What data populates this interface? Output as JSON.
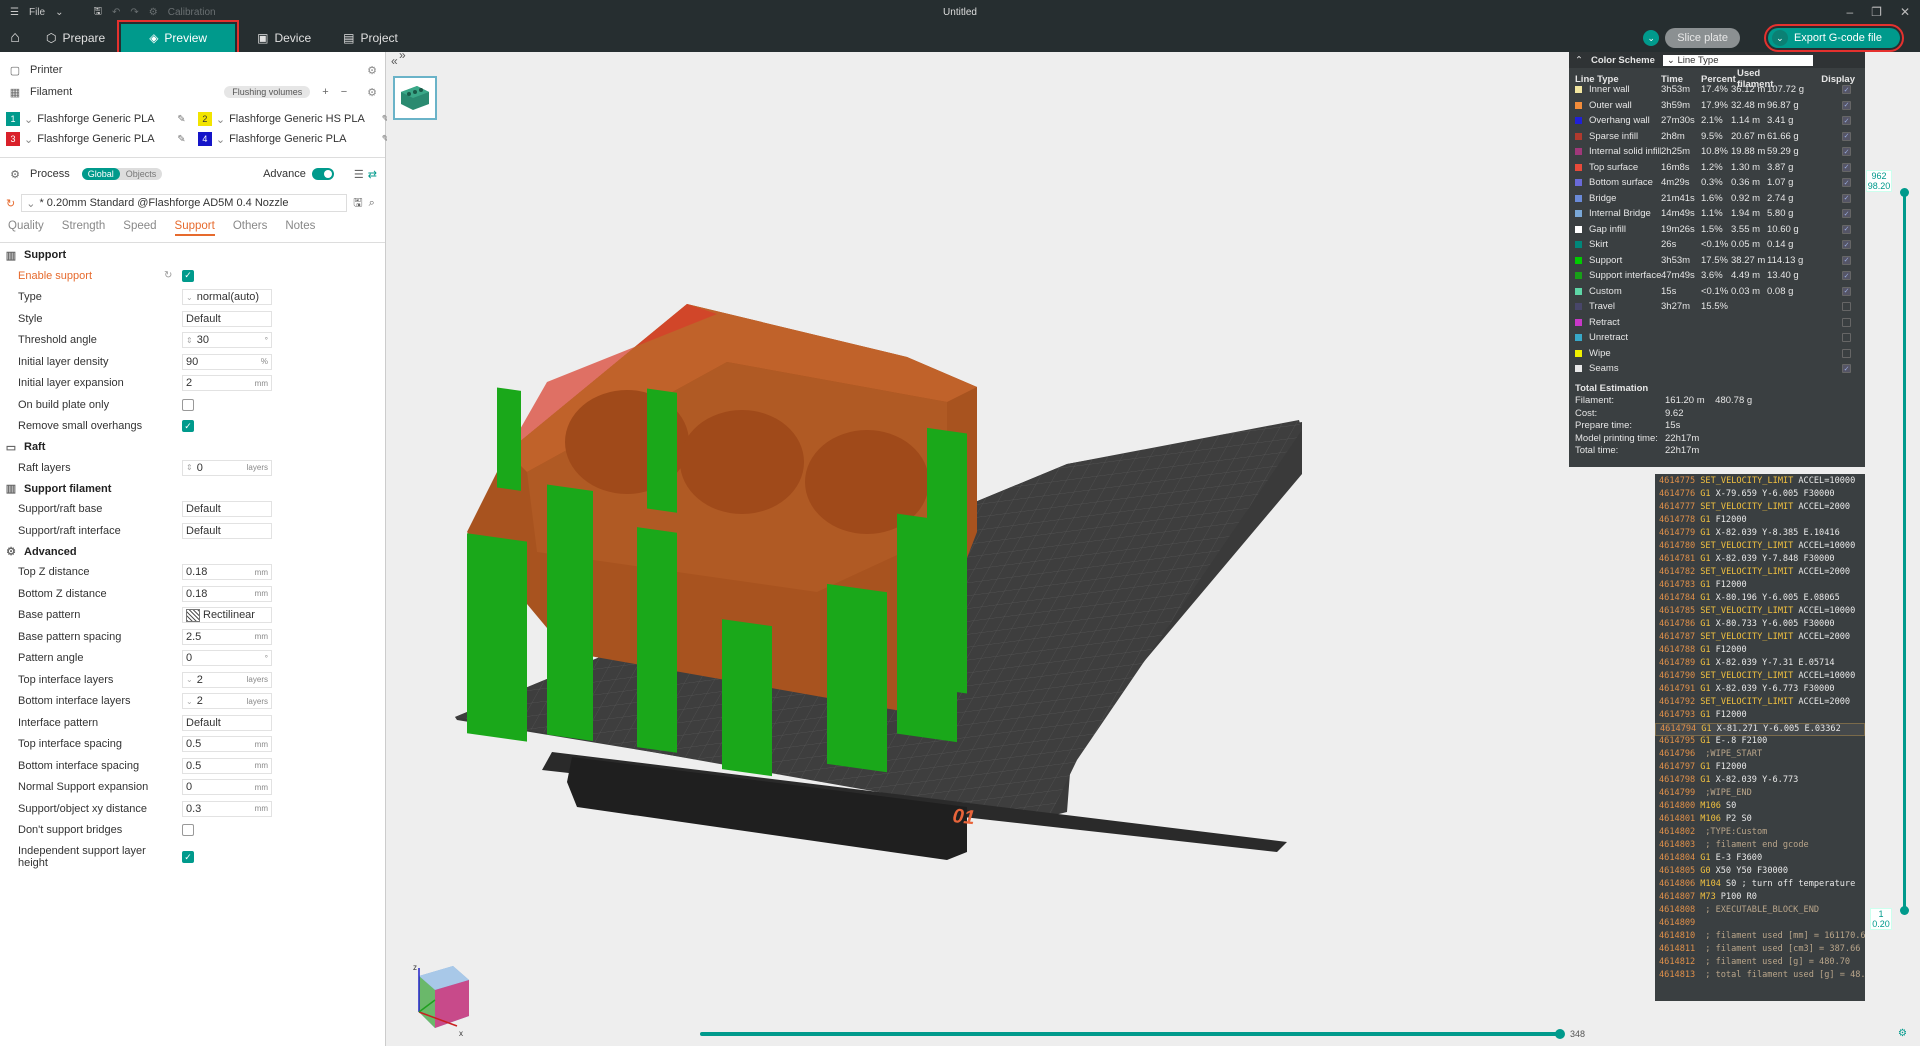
{
  "titlebar": {
    "file_label": "File",
    "calibration_label": "Calibration",
    "title": "Untitled"
  },
  "toolbar": {
    "tabs": [
      {
        "label": "Prepare",
        "icon": "cube-icon"
      },
      {
        "label": "Preview",
        "icon": "layers-icon"
      },
      {
        "label": "Device",
        "icon": "device-icon"
      },
      {
        "label": "Project",
        "icon": "project-icon"
      }
    ],
    "slice_label": "Slice plate",
    "export_label": "Export G-code file"
  },
  "sidebar": {
    "printer_label": "Printer",
    "filament_label": "Filament",
    "flushing_label": "Flushing volumes",
    "filaments": [
      {
        "num": "1",
        "name": "Flashforge Generic PLA",
        "color": "#009a8c"
      },
      {
        "num": "2",
        "name": "Flashforge Generic HS PLA",
        "color": "#f2e400"
      },
      {
        "num": "3",
        "name": "Flashforge Generic PLA",
        "color": "#d9212a"
      },
      {
        "num": "4",
        "name": "Flashforge Generic PLA",
        "color": "#1515c8"
      }
    ],
    "process_label": "Process",
    "global_label": "Global",
    "objects_label": "Objects",
    "advance_label": "Advance",
    "preset": "* 0.20mm Standard @Flashforge AD5M 0.4 Nozzle",
    "subtabs": [
      "Quality",
      "Strength",
      "Speed",
      "Support",
      "Others",
      "Notes"
    ],
    "support_section": "Support",
    "enable_support": "Enable support",
    "type_label": "Type",
    "type_value": "normal(auto)",
    "style_label": "Style",
    "style_value": "Default",
    "threshold_label": "Threshold angle",
    "threshold_value": "30",
    "threshold_unit": "°",
    "init_density_label": "Initial layer density",
    "init_density_value": "90",
    "init_density_unit": "%",
    "init_expansion_label": "Initial layer expansion",
    "init_expansion_value": "2",
    "mm": "mm",
    "on_plate_label": "On build plate only",
    "remove_small_label": "Remove small overhangs",
    "raft_section": "Raft",
    "raft_layers_label": "Raft layers",
    "raft_layers_value": "0",
    "layers_unit": "layers",
    "support_filament_section": "Support filament",
    "raft_base_label": "Support/raft base",
    "raft_base_value": "Default",
    "raft_interface_label": "Support/raft interface",
    "raft_interface_value": "Default",
    "advanced_section": "Advanced",
    "top_z_label": "Top Z distance",
    "top_z_value": "0.18",
    "bottom_z_label": "Bottom Z distance",
    "bottom_z_value": "0.18",
    "base_pattern_label": "Base pattern",
    "base_pattern_value": "Rectilinear",
    "base_spacing_label": "Base pattern spacing",
    "base_spacing_value": "2.5",
    "pattern_angle_label": "Pattern angle",
    "pattern_angle_value": "0",
    "top_interface_layers_label": "Top interface layers",
    "top_interface_layers_value": "2",
    "bottom_interface_layers_label": "Bottom interface layers",
    "bottom_interface_layers_value": "2",
    "interface_pattern_label": "Interface pattern",
    "interface_pattern_value": "Default",
    "top_interface_spacing_label": "Top interface spacing",
    "top_interface_spacing_value": "0.5",
    "bottom_interface_spacing_label": "Bottom interface spacing",
    "bottom_interface_spacing_value": "0.5",
    "normal_expansion_label": "Normal Support expansion",
    "normal_expansion_value": "0",
    "xy_distance_label": "Support/object xy distance",
    "xy_distance_value": "0.3",
    "dont_bridges_label": "Don't support bridges",
    "independent_height_label": "Independent support layer height"
  },
  "legend": {
    "color_scheme_label": "Color Scheme",
    "line_type_selector": "Line Type",
    "columns": [
      "Line Type",
      "Time",
      "Percent",
      "Used filament",
      "Display"
    ],
    "rows": [
      {
        "name": "Inner wall",
        "color": "#f2e6a0",
        "time": "3h53m",
        "pct": "17.4%",
        "len": "36.12 m",
        "g": "107.72 g",
        "display": true
      },
      {
        "name": "Outer wall",
        "color": "#f28c3a",
        "time": "3h59m",
        "pct": "17.9%",
        "len": "32.48 m",
        "g": "96.87 g",
        "display": true
      },
      {
        "name": "Overhang wall",
        "color": "#2020d8",
        "time": "27m30s",
        "pct": "2.1%",
        "len": "1.14 m",
        "g": "3.41 g",
        "display": true
      },
      {
        "name": "Sparse infill",
        "color": "#b03a2e",
        "time": "2h8m",
        "pct": "9.5%",
        "len": "20.67 m",
        "g": "61.66 g",
        "display": true
      },
      {
        "name": "Internal solid infill",
        "color": "#a0387a",
        "time": "2h25m",
        "pct": "10.8%",
        "len": "19.88 m",
        "g": "59.29 g",
        "display": true
      },
      {
        "name": "Top surface",
        "color": "#e84a3a",
        "time": "16m8s",
        "pct": "1.2%",
        "len": "1.30 m",
        "g": "3.87 g",
        "display": true
      },
      {
        "name": "Bottom surface",
        "color": "#6a6ad8",
        "time": "4m29s",
        "pct": "0.3%",
        "len": "0.36 m",
        "g": "1.07 g",
        "display": true
      },
      {
        "name": "Bridge",
        "color": "#6a8ad8",
        "time": "21m41s",
        "pct": "1.6%",
        "len": "0.92 m",
        "g": "2.74 g",
        "display": true
      },
      {
        "name": "Internal Bridge",
        "color": "#7aa8d8",
        "time": "14m49s",
        "pct": "1.1%",
        "len": "1.94 m",
        "g": "5.80 g",
        "display": true
      },
      {
        "name": "Gap infill",
        "color": "#ffffff",
        "time": "19m26s",
        "pct": "1.5%",
        "len": "3.55 m",
        "g": "10.60 g",
        "display": true
      },
      {
        "name": "Skirt",
        "color": "#00877a",
        "time": "26s",
        "pct": "<0.1%",
        "len": "0.05 m",
        "g": "0.14 g",
        "display": true
      },
      {
        "name": "Support",
        "color": "#00cc00",
        "time": "3h53m",
        "pct": "17.5%",
        "len": "38.27 m",
        "g": "114.13 g",
        "display": true
      },
      {
        "name": "Support interface",
        "color": "#18a018",
        "time": "47m49s",
        "pct": "3.6%",
        "len": "4.49 m",
        "g": "13.40 g",
        "display": true
      },
      {
        "name": "Custom",
        "color": "#5ed6a6",
        "time": "15s",
        "pct": "<0.1%",
        "len": "0.03 m",
        "g": "0.08 g",
        "display": true
      },
      {
        "name": "Travel",
        "color": "#48466a",
        "time": "3h27m",
        "pct": "15.5%",
        "len": "",
        "g": "",
        "display": false
      },
      {
        "name": "Retract",
        "color": "#c838c8",
        "time": "",
        "pct": "",
        "len": "",
        "g": "",
        "display": false
      },
      {
        "name": "Unretract",
        "color": "#38a8c8",
        "time": "",
        "pct": "",
        "len": "",
        "g": "",
        "display": false
      },
      {
        "name": "Wipe",
        "color": "#f0f000",
        "time": "",
        "pct": "",
        "len": "",
        "g": "",
        "display": false
      },
      {
        "name": "Seams",
        "color": "#e8e8e8",
        "time": "",
        "pct": "",
        "len": "",
        "g": "",
        "display": true
      }
    ],
    "total_title": "Total Estimation",
    "totals": [
      {
        "k": "Filament:",
        "v": "161.20 m    480.78 g"
      },
      {
        "k": "Cost:",
        "v": "9.62"
      },
      {
        "k": "Prepare time:",
        "v": "15s"
      },
      {
        "k": "Model printing time:",
        "v": "22h17m"
      },
      {
        "k": "Total time:",
        "v": "22h17m"
      }
    ]
  },
  "gcode": {
    "lines": [
      {
        "n": "4614775",
        "cmd": "SET_VELOCITY_LIMIT",
        "args": "ACCEL=10000"
      },
      {
        "n": "4614776",
        "cmd": "G1",
        "args": "X-79.659 Y-6.005 F30000"
      },
      {
        "n": "4614777",
        "cmd": "SET_VELOCITY_LIMIT",
        "args": "ACCEL=2000"
      },
      {
        "n": "4614778",
        "cmd": "G1",
        "args": "F12000"
      },
      {
        "n": "4614779",
        "cmd": "G1",
        "args": "X-82.039 Y-8.385 E.10416"
      },
      {
        "n": "4614780",
        "cmd": "SET_VELOCITY_LIMIT",
        "args": "ACCEL=10000"
      },
      {
        "n": "4614781",
        "cmd": "G1",
        "args": "X-82.039 Y-7.848 F30000"
      },
      {
        "n": "4614782",
        "cmd": "SET_VELOCITY_LIMIT",
        "args": "ACCEL=2000"
      },
      {
        "n": "4614783",
        "cmd": "G1",
        "args": "F12000"
      },
      {
        "n": "4614784",
        "cmd": "G1",
        "args": "X-80.196 Y-6.005 E.08065"
      },
      {
        "n": "4614785",
        "cmd": "SET_VELOCITY_LIMIT",
        "args": "ACCEL=10000"
      },
      {
        "n": "4614786",
        "cmd": "G1",
        "args": "X-80.733 Y-6.005 F30000"
      },
      {
        "n": "4614787",
        "cmd": "SET_VELOCITY_LIMIT",
        "args": "ACCEL=2000"
      },
      {
        "n": "4614788",
        "cmd": "G1",
        "args": "F12000"
      },
      {
        "n": "4614789",
        "cmd": "G1",
        "args": "X-82.039 Y-7.31 E.05714"
      },
      {
        "n": "4614790",
        "cmd": "SET_VELOCITY_LIMIT",
        "args": "ACCEL=10000"
      },
      {
        "n": "4614791",
        "cmd": "G1",
        "args": "X-82.039 Y-6.773 F30000"
      },
      {
        "n": "4614792",
        "cmd": "SET_VELOCITY_LIMIT",
        "args": "ACCEL=2000"
      },
      {
        "n": "4614793",
        "cmd": "G1",
        "args": "F12000"
      },
      {
        "n": "4614794",
        "cmd": "G1",
        "args": "X-81.271 Y-6.005 E.03362",
        "selected": true
      },
      {
        "n": "4614795",
        "cmd": "G1",
        "args": "E-.8 F2100"
      },
      {
        "n": "4614796",
        "cmd": "",
        "args": ";WIPE_START"
      },
      {
        "n": "4614797",
        "cmd": "G1",
        "args": "F12000"
      },
      {
        "n": "4614798",
        "cmd": "G1",
        "args": "X-82.039 Y-6.773"
      },
      {
        "n": "4614799",
        "cmd": "",
        "args": ";WIPE_END"
      },
      {
        "n": "4614800",
        "cmd": "M106",
        "args": "S0"
      },
      {
        "n": "4614801",
        "cmd": "M106",
        "args": "P2 S0"
      },
      {
        "n": "4614802",
        "cmd": "",
        "args": ";TYPE:Custom"
      },
      {
        "n": "4614803",
        "cmd": "",
        "args": "; filament end gcode"
      },
      {
        "n": "4614804",
        "cmd": "G1",
        "args": "E-3 F3600"
      },
      {
        "n": "4614805",
        "cmd": "G0",
        "args": "X50 Y50 F30000"
      },
      {
        "n": "4614806",
        "cmd": "M104",
        "args": "S0 ; turn off temperature"
      },
      {
        "n": "4614807",
        "cmd": "M73",
        "args": "P100 R0"
      },
      {
        "n": "4614808",
        "cmd": "",
        "args": "; EXECUTABLE_BLOCK_END"
      },
      {
        "n": "4614809",
        "cmd": "",
        "args": ""
      },
      {
        "n": "4614810",
        "cmd": "",
        "args": "; filament used [mm] = 161170.64"
      },
      {
        "n": "4614811",
        "cmd": "",
        "args": "; filament used [cm3] = 387.66"
      },
      {
        "n": "4614812",
        "cmd": "",
        "args": "; filament used [g] = 480.70"
      },
      {
        "n": "4614813",
        "cmd": "",
        "args": "; total filament used [g] = 48..."
      }
    ]
  },
  "layer_slider": {
    "top_layer": "962",
    "top_height": "98.20",
    "bottom_layer": "1",
    "bottom_height": "0.20"
  },
  "move_slider": {
    "value": "348"
  },
  "plate": {
    "number": "01"
  },
  "axis": {
    "z": "z",
    "x": "x"
  }
}
